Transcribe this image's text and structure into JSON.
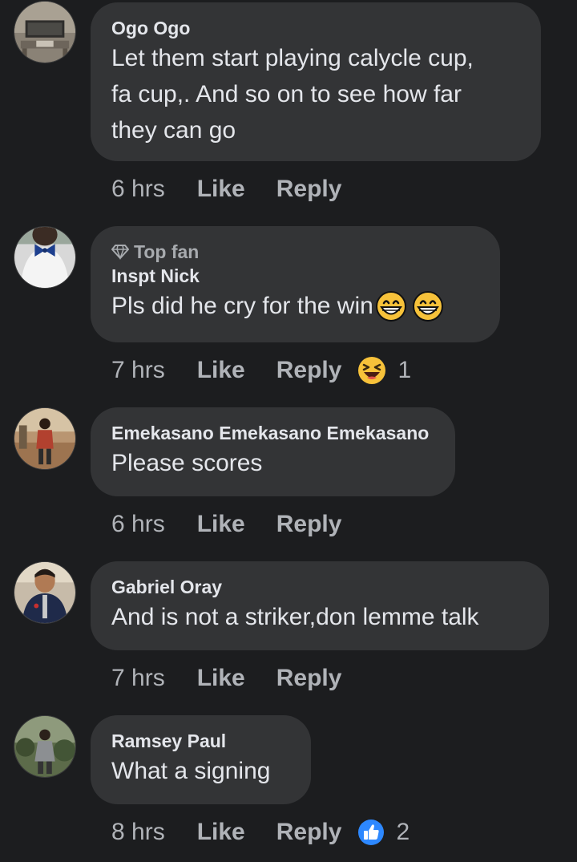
{
  "comments": [
    {
      "author": "Ogo Ogo",
      "lines": [
        "Let them start playing calycle cup,",
        "fa cup,. And so on to see how far",
        "they can go"
      ],
      "time": "6 hrs",
      "like": "Like",
      "reply": "Reply"
    },
    {
      "badge_icon": "diamond-icon",
      "badge": "Top fan",
      "author": "Inspt Nick",
      "text": "Pls did he cry for the win",
      "emojis": [
        "grinning-face-icon",
        "grinning-face-icon"
      ],
      "time": "7 hrs",
      "like": "Like",
      "reply": "Reply",
      "reaction_icon": "laughing-face-icon",
      "reaction_count": "1"
    },
    {
      "author": "Emekasano Emekasano Emekasano",
      "text": "Please scores",
      "time": "6 hrs",
      "like": "Like",
      "reply": "Reply"
    },
    {
      "author": "Gabriel Oray",
      "text": "And is not a striker,don lemme talk",
      "time": "7 hrs",
      "like": "Like",
      "reply": "Reply"
    },
    {
      "author": "Ramsey Paul",
      "text": "What a signing",
      "time": "8 hrs",
      "like": "Like",
      "reply": "Reply",
      "reaction_icon": "thumbs-up-icon",
      "reaction_count": "2"
    }
  ],
  "colors": {
    "background": "#1c1d1f",
    "bubble": "#333436",
    "text": "#e4e6eb",
    "muted": "#b0b3b8",
    "like_blue": "#2d88ff",
    "emoji_yellow": "#f7c23a"
  }
}
